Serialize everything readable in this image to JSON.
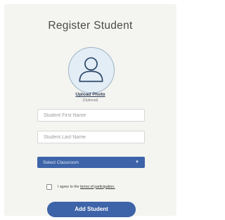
{
  "title": "Register Student",
  "photo": {
    "upload_label": "Upload Photo",
    "optional_label": "(Optional)",
    "icon": "person-silhouette-icon"
  },
  "fields": {
    "first_name": {
      "placeholder": "Student First Name",
      "value": ""
    },
    "last_name": {
      "placeholder": "Student Last Name",
      "value": ""
    }
  },
  "classroom_select": {
    "selected": "Select Classroom",
    "icon": "chevron-down-icon"
  },
  "agreement": {
    "checked": false,
    "text": "I agree to the",
    "link_text": "terms of participation."
  },
  "submit_label": "Add Student",
  "colors": {
    "accent": "#3d64a8",
    "card_background": "#f4f4f0",
    "title_text": "#4a4a4a"
  }
}
